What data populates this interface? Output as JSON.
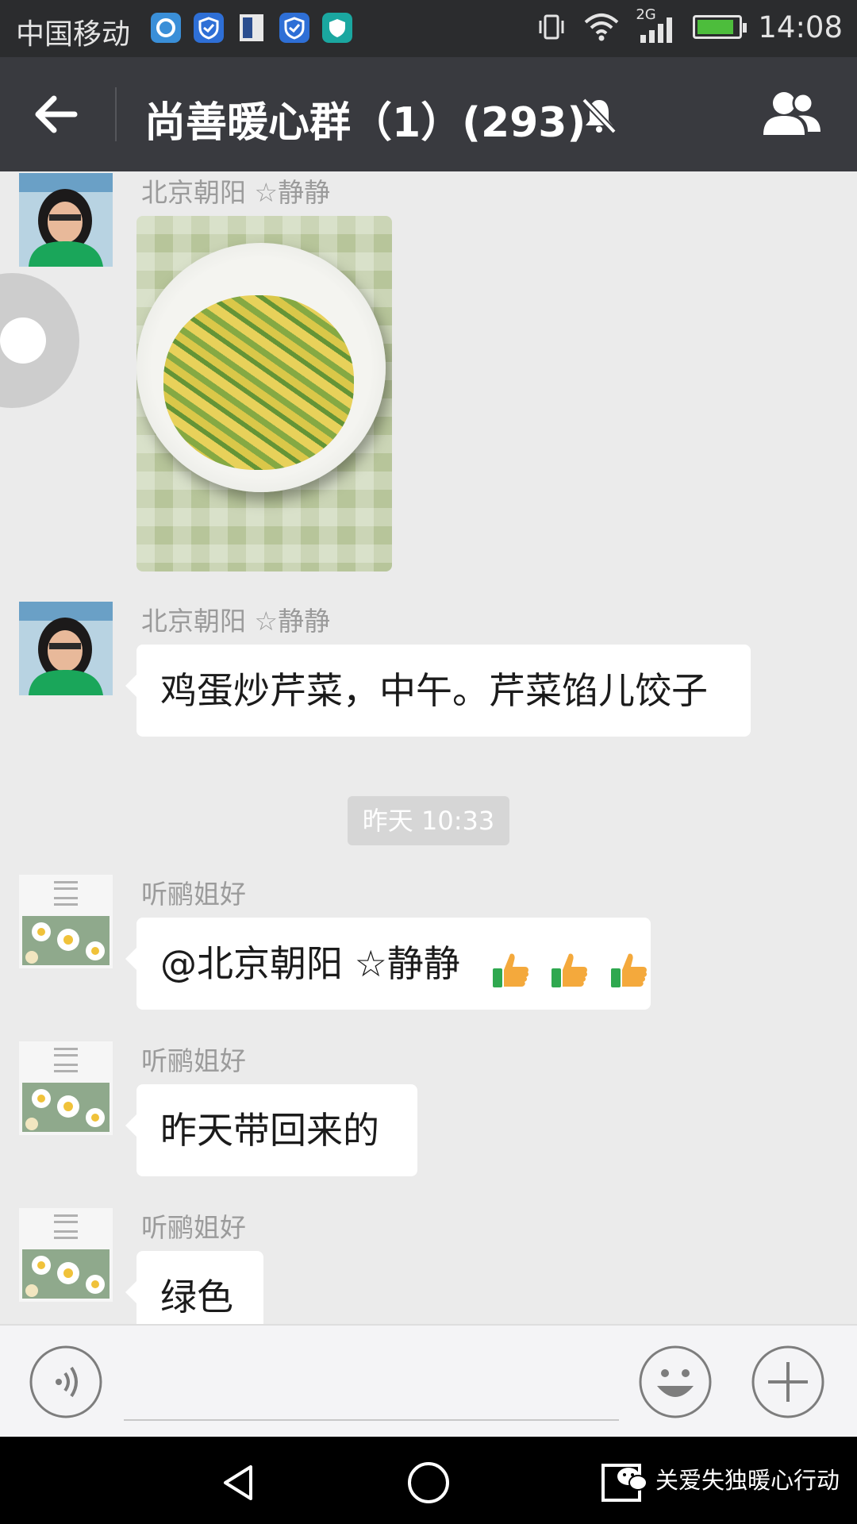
{
  "status_bar": {
    "carrier": "中国移动",
    "time": "14:08",
    "network": "2G",
    "battery_level": 0.9,
    "icons": [
      "browser-icon",
      "shield-icon",
      "sim-icon",
      "shield-icon",
      "security-icon"
    ]
  },
  "header": {
    "title": "尚善暖心群（1）(293)",
    "muted": true
  },
  "messages": [
    {
      "sender": "北京朝阳 ☆静静",
      "type": "image",
      "image": "plate-of-stir-fried-celery-and-egg"
    },
    {
      "sender": "北京朝阳 ☆静静",
      "type": "text",
      "text": "鸡蛋炒芹菜，中午。芹菜馅儿饺子"
    },
    {
      "type": "timestamp",
      "text": "昨天 10:33"
    },
    {
      "sender": "听鹂姐好",
      "type": "text",
      "text": "@北京朝阳 ☆静静",
      "emoji": [
        "thumbs-up",
        "thumbs-up",
        "thumbs-up"
      ]
    },
    {
      "sender": "听鹂姐好",
      "type": "text",
      "text": "昨天带回来的"
    },
    {
      "sender": "听鹂姐好",
      "type": "text",
      "text": "绿色"
    }
  ],
  "input_bar": {
    "voice": "voice-icon",
    "emoji": "smiley-icon",
    "more": "plus-icon"
  },
  "nav_bar": {
    "watermark": "关爱失独暖心行动"
  },
  "colors": {
    "status_bar": "#2b2c2e",
    "title_bar": "#393a3f",
    "chat_background": "#ebebeb",
    "bubble": "#ffffff",
    "battery": "#4dbd3c"
  }
}
